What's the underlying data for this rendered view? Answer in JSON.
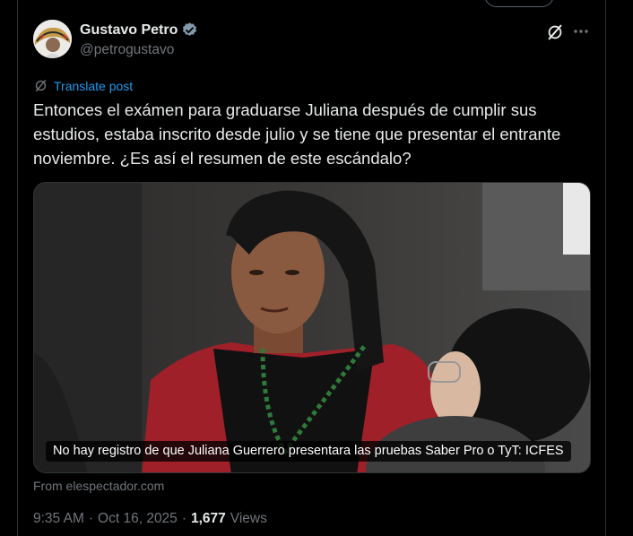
{
  "author": {
    "name": "Gustavo Petro",
    "handle": "@petrogustavo"
  },
  "translate_label": "Translate post",
  "post_text": "Entonces el exámen para graduarse Juliana después de cumplir sus estudios, estaba inscrito desde julio y se tiene que presentar el entrante noviembre. ¿Es así el resumen de este escándalo?",
  "media": {
    "caption": "No hay registro de que Juliana Guerrero presentara las pruebas Saber Pro o TyT: ICFES"
  },
  "source": "From elespectador.com",
  "meta": {
    "time": "9:35 AM",
    "separator": "·",
    "date": "Oct 16, 2025",
    "separator2": "·",
    "views_count": "1,677",
    "views_label": "Views"
  },
  "icons": {
    "verified": "verified-badge-icon",
    "grok": "grok-icon",
    "more": "more-icon",
    "translate": "translate-icon"
  },
  "colors": {
    "background": "#000000",
    "text": "#e7e9ea",
    "secondary": "#71767b",
    "accent": "#1d9bf0"
  }
}
